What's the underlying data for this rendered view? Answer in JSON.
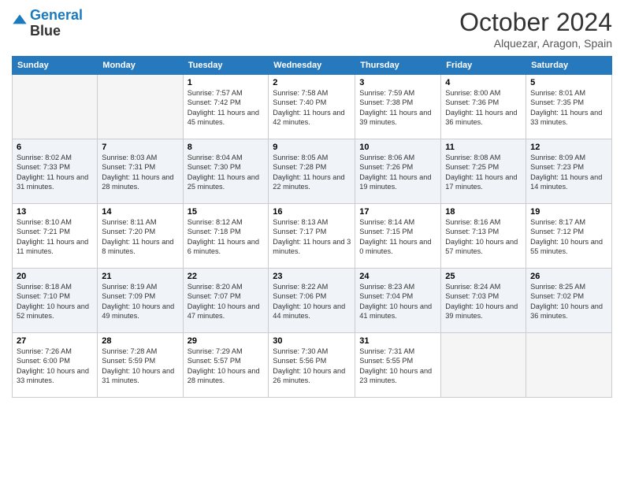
{
  "logo": {
    "line1": "General",
    "line2": "Blue"
  },
  "title": "October 2024",
  "location": "Alquezar, Aragon, Spain",
  "days_header": [
    "Sunday",
    "Monday",
    "Tuesday",
    "Wednesday",
    "Thursday",
    "Friday",
    "Saturday"
  ],
  "weeks": [
    [
      {
        "day": "",
        "info": ""
      },
      {
        "day": "",
        "info": ""
      },
      {
        "day": "1",
        "info": "Sunrise: 7:57 AM\nSunset: 7:42 PM\nDaylight: 11 hours and 45 minutes."
      },
      {
        "day": "2",
        "info": "Sunrise: 7:58 AM\nSunset: 7:40 PM\nDaylight: 11 hours and 42 minutes."
      },
      {
        "day": "3",
        "info": "Sunrise: 7:59 AM\nSunset: 7:38 PM\nDaylight: 11 hours and 39 minutes."
      },
      {
        "day": "4",
        "info": "Sunrise: 8:00 AM\nSunset: 7:36 PM\nDaylight: 11 hours and 36 minutes."
      },
      {
        "day": "5",
        "info": "Sunrise: 8:01 AM\nSunset: 7:35 PM\nDaylight: 11 hours and 33 minutes."
      }
    ],
    [
      {
        "day": "6",
        "info": "Sunrise: 8:02 AM\nSunset: 7:33 PM\nDaylight: 11 hours and 31 minutes."
      },
      {
        "day": "7",
        "info": "Sunrise: 8:03 AM\nSunset: 7:31 PM\nDaylight: 11 hours and 28 minutes."
      },
      {
        "day": "8",
        "info": "Sunrise: 8:04 AM\nSunset: 7:30 PM\nDaylight: 11 hours and 25 minutes."
      },
      {
        "day": "9",
        "info": "Sunrise: 8:05 AM\nSunset: 7:28 PM\nDaylight: 11 hours and 22 minutes."
      },
      {
        "day": "10",
        "info": "Sunrise: 8:06 AM\nSunset: 7:26 PM\nDaylight: 11 hours and 19 minutes."
      },
      {
        "day": "11",
        "info": "Sunrise: 8:08 AM\nSunset: 7:25 PM\nDaylight: 11 hours and 17 minutes."
      },
      {
        "day": "12",
        "info": "Sunrise: 8:09 AM\nSunset: 7:23 PM\nDaylight: 11 hours and 14 minutes."
      }
    ],
    [
      {
        "day": "13",
        "info": "Sunrise: 8:10 AM\nSunset: 7:21 PM\nDaylight: 11 hours and 11 minutes."
      },
      {
        "day": "14",
        "info": "Sunrise: 8:11 AM\nSunset: 7:20 PM\nDaylight: 11 hours and 8 minutes."
      },
      {
        "day": "15",
        "info": "Sunrise: 8:12 AM\nSunset: 7:18 PM\nDaylight: 11 hours and 6 minutes."
      },
      {
        "day": "16",
        "info": "Sunrise: 8:13 AM\nSunset: 7:17 PM\nDaylight: 11 hours and 3 minutes."
      },
      {
        "day": "17",
        "info": "Sunrise: 8:14 AM\nSunset: 7:15 PM\nDaylight: 11 hours and 0 minutes."
      },
      {
        "day": "18",
        "info": "Sunrise: 8:16 AM\nSunset: 7:13 PM\nDaylight: 10 hours and 57 minutes."
      },
      {
        "day": "19",
        "info": "Sunrise: 8:17 AM\nSunset: 7:12 PM\nDaylight: 10 hours and 55 minutes."
      }
    ],
    [
      {
        "day": "20",
        "info": "Sunrise: 8:18 AM\nSunset: 7:10 PM\nDaylight: 10 hours and 52 minutes."
      },
      {
        "day": "21",
        "info": "Sunrise: 8:19 AM\nSunset: 7:09 PM\nDaylight: 10 hours and 49 minutes."
      },
      {
        "day": "22",
        "info": "Sunrise: 8:20 AM\nSunset: 7:07 PM\nDaylight: 10 hours and 47 minutes."
      },
      {
        "day": "23",
        "info": "Sunrise: 8:22 AM\nSunset: 7:06 PM\nDaylight: 10 hours and 44 minutes."
      },
      {
        "day": "24",
        "info": "Sunrise: 8:23 AM\nSunset: 7:04 PM\nDaylight: 10 hours and 41 minutes."
      },
      {
        "day": "25",
        "info": "Sunrise: 8:24 AM\nSunset: 7:03 PM\nDaylight: 10 hours and 39 minutes."
      },
      {
        "day": "26",
        "info": "Sunrise: 8:25 AM\nSunset: 7:02 PM\nDaylight: 10 hours and 36 minutes."
      }
    ],
    [
      {
        "day": "27",
        "info": "Sunrise: 7:26 AM\nSunset: 6:00 PM\nDaylight: 10 hours and 33 minutes."
      },
      {
        "day": "28",
        "info": "Sunrise: 7:28 AM\nSunset: 5:59 PM\nDaylight: 10 hours and 31 minutes."
      },
      {
        "day": "29",
        "info": "Sunrise: 7:29 AM\nSunset: 5:57 PM\nDaylight: 10 hours and 28 minutes."
      },
      {
        "day": "30",
        "info": "Sunrise: 7:30 AM\nSunset: 5:56 PM\nDaylight: 10 hours and 26 minutes."
      },
      {
        "day": "31",
        "info": "Sunrise: 7:31 AM\nSunset: 5:55 PM\nDaylight: 10 hours and 23 minutes."
      },
      {
        "day": "",
        "info": ""
      },
      {
        "day": "",
        "info": ""
      }
    ]
  ]
}
